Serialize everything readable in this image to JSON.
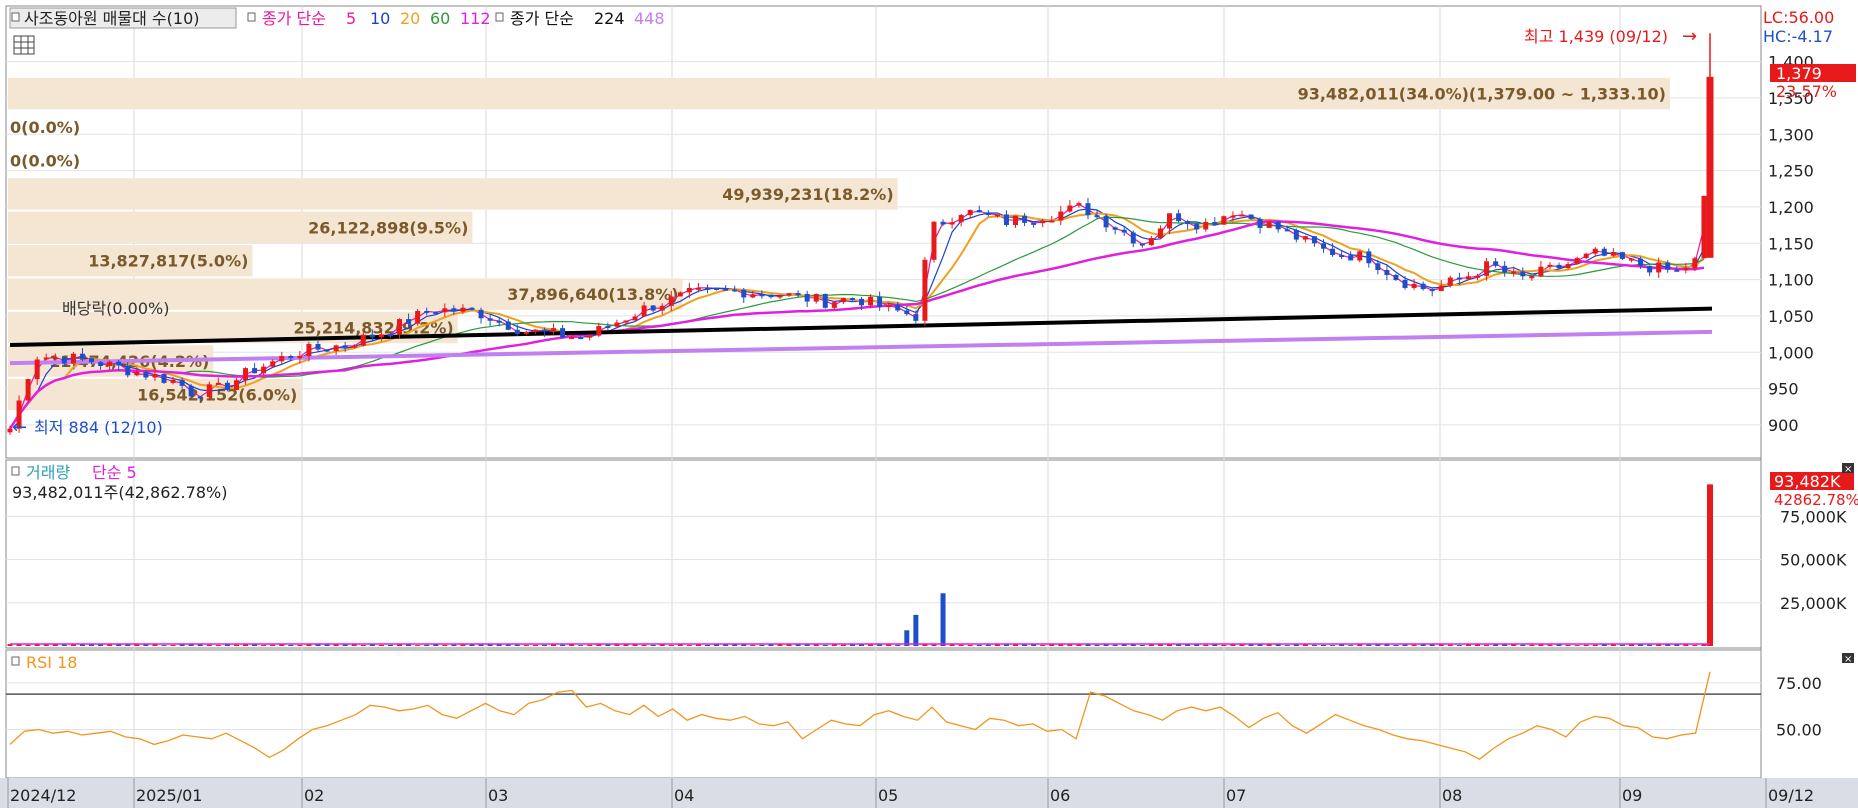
{
  "legend": {
    "volume_profile": "사조동아원 매물대 수(10)",
    "ma_prefix": "종가 단순",
    "ma_periods": [
      "5",
      "10",
      "20",
      "60",
      "112"
    ],
    "ma_long_prefix": "종가 단순",
    "ma_long": [
      "224",
      "448"
    ],
    "volume_title": "거래량",
    "volume_ma": "단순 5",
    "volume_info": "93,482,011주(42,862.78%)",
    "rsi_title": "RSI 18"
  },
  "colors": {
    "up": "#e8191b",
    "down": "#1f4fc8",
    "ma5": "#e8199c",
    "ma10": "#1f3fd0",
    "ma20": "#f0a020",
    "ma60": "#2a9a3a",
    "ma112": "#e020e0",
    "ma224": "#000000",
    "ma448": "#c080f0",
    "profile": "#f5e6d3",
    "profile_text": "#7a5a2a",
    "rsi": "#f0961e",
    "volume_ma": "#e020e0"
  },
  "annotations": {
    "high": "최고 1,439 (09/12)",
    "low": "최저 884 (12/10)",
    "dividend": "배당락(0.00%)",
    "lc": "LC:56.00",
    "hc": "HC:-4.17",
    "last_price": "1,379",
    "last_change": "23.57%",
    "vol_last": "93,482K",
    "vol_last_pct": "42862.78%"
  },
  "chart_data": {
    "type": "candlestick",
    "price_axis": {
      "ticks": [
        "1,400",
        "1,350",
        "1,300",
        "1,250",
        "1,200",
        "1,150",
        "1,100",
        "1,050",
        "1,000",
        "950",
        "900"
      ],
      "ylim": [
        860,
        1460
      ]
    },
    "volume_axis": {
      "ticks": [
        "75,000K",
        "50,000K",
        "25,000K"
      ],
      "ylim": [
        0,
        96000
      ]
    },
    "rsi_axis": {
      "ticks": [
        "75.00",
        "50.00"
      ],
      "ylim": [
        25,
        90
      ],
      "baseline": 69
    },
    "x_ticks": [
      "2024/12",
      "2025/01",
      "02",
      "03",
      "04",
      "05",
      "06",
      "07",
      "08",
      "09",
      "09/12"
    ],
    "volume_profile": [
      {
        "label": "93,482,011(34.0%)(1,379.00 ~ 1,333.10)",
        "price": 1356,
        "pct": 34.0
      },
      {
        "label": "0(0.0%)",
        "price": 1310,
        "pct": 0
      },
      {
        "label": "0(0.0%)",
        "price": 1264,
        "pct": 0
      },
      {
        "label": "49,939,231(18.2%)",
        "price": 1218,
        "pct": 18.2
      },
      {
        "label": "26,122,898(9.5%)",
        "price": 1172,
        "pct": 9.5
      },
      {
        "label": "13,827,817(5.0%)",
        "price": 1126,
        "pct": 5.0
      },
      {
        "label": "37,896,640(13.8%)",
        "price": 1080,
        "pct": 13.8
      },
      {
        "label": "25,214,832(9.2%)",
        "price": 1034,
        "pct": 9.2
      },
      {
        "label": "11,474,426(4.2%)",
        "price": 988,
        "pct": 4.2
      },
      {
        "label": "16,542,152(6.0%)",
        "price": 942,
        "pct": 6.0
      }
    ],
    "ma224": [
      1010,
      1060
    ],
    "ma448": [
      985,
      1028
    ],
    "rsi_values": [
      42,
      49,
      50,
      48,
      49,
      47,
      48,
      49,
      46,
      45,
      42,
      44,
      47,
      46,
      45,
      48,
      44,
      40,
      35,
      39,
      45,
      50,
      52,
      55,
      58,
      63,
      62,
      60,
      61,
      63,
      58,
      56,
      60,
      64,
      60,
      58,
      64,
      66,
      70,
      71,
      62,
      64,
      60,
      58,
      63,
      57,
      61,
      55,
      58,
      56,
      55,
      57,
      53,
      52,
      54,
      45,
      50,
      55,
      53,
      52,
      58,
      60,
      57,
      55,
      62,
      54,
      52,
      50,
      56,
      55,
      52,
      53,
      49,
      50,
      45,
      70,
      68,
      64,
      60,
      58,
      55,
      60,
      62,
      60,
      62,
      57,
      51,
      56,
      59,
      52,
      48,
      53,
      58,
      55,
      52,
      50,
      47,
      45,
      44,
      42,
      40,
      38,
      34,
      40,
      45,
      48,
      52,
      50,
      46,
      54,
      57,
      56,
      52,
      51,
      46,
      45,
      47,
      48,
      81
    ]
  }
}
